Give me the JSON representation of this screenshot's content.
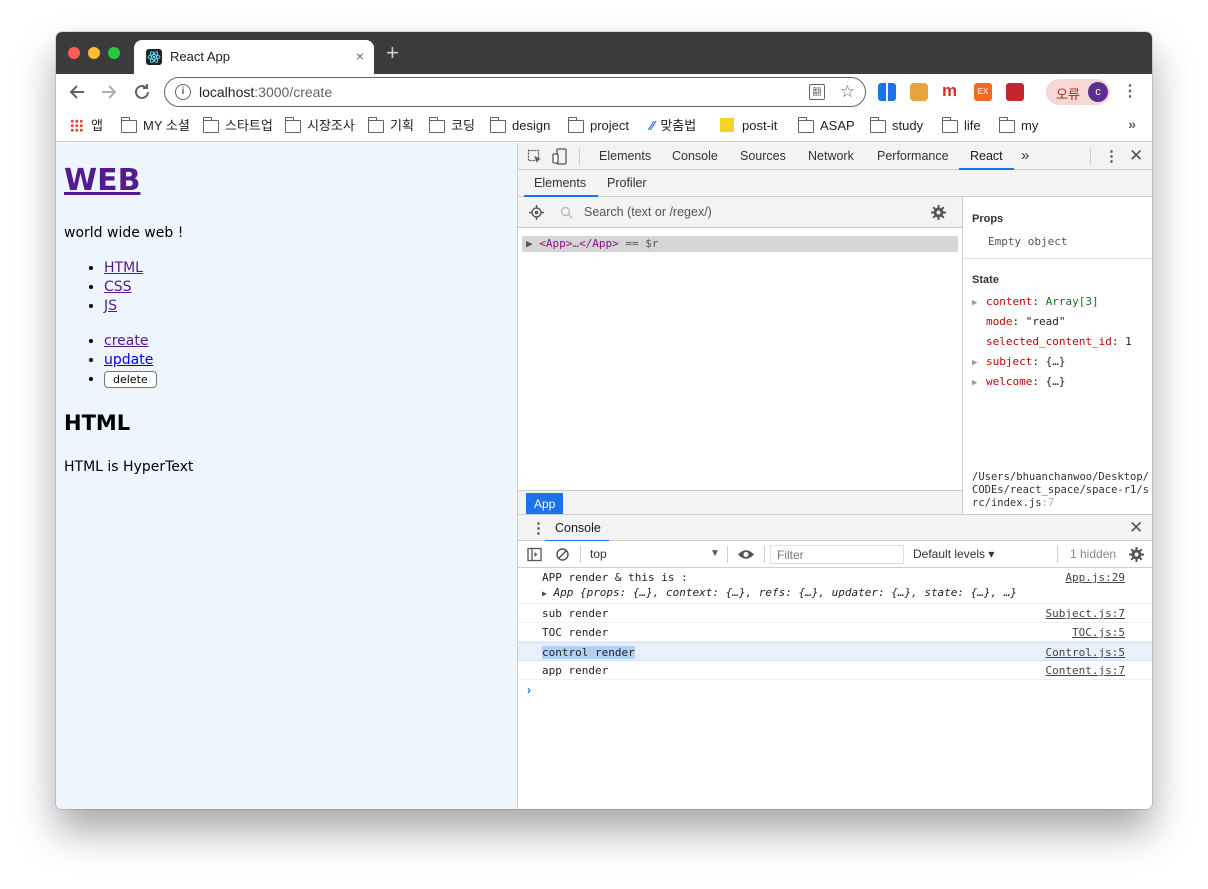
{
  "browser": {
    "tab_title": "React App",
    "tab_close": "×",
    "new_tab": "+",
    "url_host": "localhost",
    "url_path": ":3000/create",
    "translate_icon": "翻",
    "profile_label": "오류",
    "profile_initial": "c"
  },
  "bookmarks": [
    "앱",
    "MY 소셜",
    "스타트업",
    "시장조사",
    "기획",
    "코딩",
    "design",
    "project",
    "맞춤법",
    "post-it",
    "ASAP",
    "study",
    "life",
    "my"
  ],
  "page": {
    "title": "WEB",
    "subtitle": "world wide web !",
    "toc": [
      "HTML",
      "CSS",
      "JS"
    ],
    "controls": [
      "create",
      "update"
    ],
    "delete_label": "delete",
    "content_title": "HTML",
    "content_desc": "HTML is HyperText"
  },
  "devtools": {
    "tabs": [
      "Elements",
      "Console",
      "Sources",
      "Network",
      "Performance",
      "React"
    ],
    "more_tabs": "»",
    "subtabs": [
      "Elements",
      "Profiler"
    ],
    "search_placeholder": "Search (text or /regex/)",
    "tree_row": {
      "open": "<App>",
      "ellipsis": "…",
      "close": "</App>",
      "suffix": " == $r"
    },
    "selected_chip": "App",
    "props_heading": "Props",
    "props_empty": "Empty object",
    "state_heading": "State",
    "state": [
      {
        "key": "content",
        "value": "Array[3]",
        "expandable": true
      },
      {
        "key": "mode",
        "value": "\"read\"",
        "expandable": false
      },
      {
        "key": "selected_content_id",
        "value": "1",
        "expandable": false
      },
      {
        "key": "subject",
        "value": "{…}",
        "expandable": true
      },
      {
        "key": "welcome",
        "value": "{…}",
        "expandable": true
      }
    ],
    "source_path": "/Users/bhuanchanwoo/Desktop/CODEs/react_space/space-r1/src/index.js",
    "source_line": ":7"
  },
  "console": {
    "tab": "Console",
    "context": "top",
    "filter_placeholder": "Filter",
    "levels": "Default levels ▾",
    "hidden": "1 hidden",
    "messages": [
      {
        "text": "APP render & this is :",
        "source": "App.js:29",
        "detail": "App {props: {…}, context: {…}, refs: {…}, updater: {…}, state: {…}, …}"
      },
      {
        "text": "sub render",
        "source": "Subject.js:7"
      },
      {
        "text": "TOC render",
        "source": "TOC.js:5"
      },
      {
        "text": "control render",
        "source": "Control.js:5",
        "highlighted": true
      },
      {
        "text": "app render",
        "source": "Content.js:7"
      }
    ]
  }
}
